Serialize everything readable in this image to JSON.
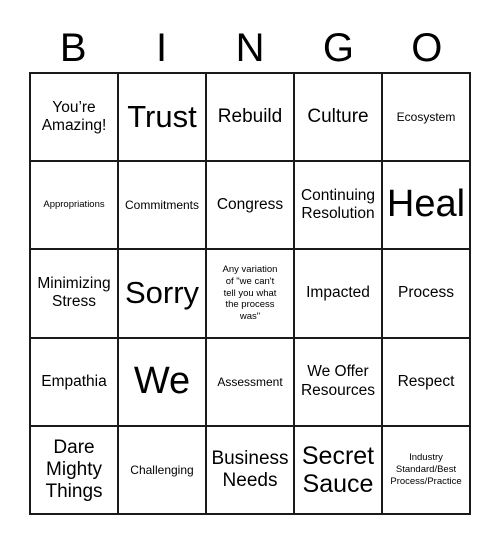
{
  "header": {
    "letters": [
      "B",
      "I",
      "N",
      "G",
      "O"
    ]
  },
  "grid": {
    "rows": 5,
    "columns": 5,
    "border_color": "#1a1a1a",
    "background_color": "#ffffff",
    "text_color": "#000000",
    "cells": [
      {
        "text": "You’re\nAmazing!",
        "size": "md"
      },
      {
        "text": "Trust",
        "size": "xxl"
      },
      {
        "text": "Rebuild",
        "size": "lg"
      },
      {
        "text": "Culture",
        "size": "lg"
      },
      {
        "text": "Ecosystem",
        "size": "sm"
      },
      {
        "text": "Appropriations",
        "size": "xs"
      },
      {
        "text": "Commitments",
        "size": "sm"
      },
      {
        "text": "Congress",
        "size": "md"
      },
      {
        "text": "Continuing\nResolution",
        "size": "md"
      },
      {
        "text": "Heal",
        "size": "huge"
      },
      {
        "text": "Minimizing\nStress",
        "size": "md"
      },
      {
        "text": "Sorry",
        "size": "xxl"
      },
      {
        "text": "Any variation\nof \"we can't\ntell you what\nthe process\nwas\"",
        "size": "xs"
      },
      {
        "text": "Impacted",
        "size": "md"
      },
      {
        "text": "Process",
        "size": "md"
      },
      {
        "text": "Empathia",
        "size": "md"
      },
      {
        "text": "We",
        "size": "huge"
      },
      {
        "text": "Assessment",
        "size": "sm"
      },
      {
        "text": "We Offer\nResources",
        "size": "md"
      },
      {
        "text": "Respect",
        "size": "md"
      },
      {
        "text": "Dare\nMighty\nThings",
        "size": "lg"
      },
      {
        "text": "Challenging",
        "size": "sm"
      },
      {
        "text": "Business\nNeeds",
        "size": "lg"
      },
      {
        "text": "Secret\nSauce",
        "size": "xl"
      },
      {
        "text": "Industry\nStandard/Best\nProcess/Practice",
        "size": "xs"
      }
    ]
  }
}
